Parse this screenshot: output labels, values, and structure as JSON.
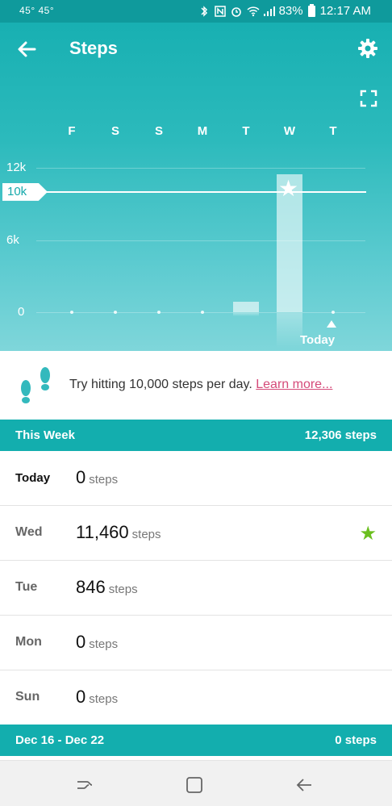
{
  "status_bar": {
    "left_text": "45° 45°",
    "battery": "83%",
    "time": "12:17 AM"
  },
  "app_bar": {
    "title": "Steps"
  },
  "chart_data": {
    "type": "bar",
    "categories": [
      "F",
      "S",
      "S",
      "M",
      "T",
      "W",
      "T"
    ],
    "values": [
      0,
      0,
      0,
      0,
      846,
      11460,
      0
    ],
    "ylim": [
      0,
      12000
    ],
    "y_ticks": [
      {
        "value": 0,
        "label": "0"
      },
      {
        "value": 6000,
        "label": "6k"
      },
      {
        "value": 12000,
        "label": "12k"
      }
    ],
    "goal": {
      "value": 10000,
      "label": "10k"
    },
    "today_label": "Today",
    "today_index": 6,
    "star_index": 5
  },
  "tip": {
    "text": "Try hitting 10,000 steps per day.",
    "link": "Learn more..."
  },
  "this_week": {
    "label": "This Week",
    "total": "12,306 steps",
    "rows": [
      {
        "day": "Today",
        "value": "0",
        "unit": "steps",
        "star": false
      },
      {
        "day": "Wed",
        "value": "11,460",
        "unit": "steps",
        "star": true
      },
      {
        "day": "Tue",
        "value": "846",
        "unit": "steps",
        "star": false
      },
      {
        "day": "Mon",
        "value": "0",
        "unit": "steps",
        "star": false
      },
      {
        "day": "Sun",
        "value": "0",
        "unit": "steps",
        "star": false
      }
    ]
  },
  "previous_week": {
    "label": "Dec 16 - Dec 22",
    "total": "0 steps"
  },
  "colors": {
    "brand": "#13aeae",
    "goal_star": "#6bbf1f",
    "link": "#d54a79"
  }
}
